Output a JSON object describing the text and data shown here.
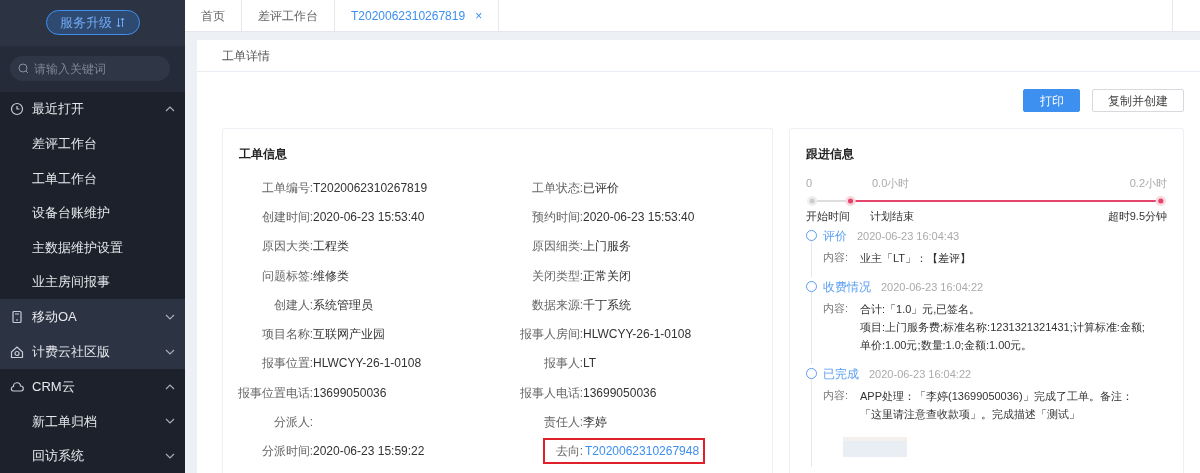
{
  "sidebar": {
    "upgrade_button": "服务升级",
    "search": {
      "placeholder": "请输入关键词"
    },
    "groups": [
      {
        "label": "最近打开",
        "expanded": true,
        "children": [
          {
            "label": "差评工作台"
          },
          {
            "label": "工单工作台"
          },
          {
            "label": "设备台账维护"
          },
          {
            "label": "主数据维护设置"
          },
          {
            "label": "业主房间报事"
          }
        ]
      },
      {
        "label": "移动OA",
        "expanded": false
      },
      {
        "label": "计费云社区版",
        "expanded": false
      },
      {
        "label": "CRM云",
        "expanded": true,
        "children": [
          {
            "label": "新工单归档",
            "expanded": false
          },
          {
            "label": "回访系统",
            "expanded": false
          }
        ]
      }
    ]
  },
  "tabs": [
    {
      "label": "首页",
      "selected": false
    },
    {
      "label": "差评工作台",
      "selected": false
    },
    {
      "label": "T2020062310267819",
      "selected": true,
      "close": "×"
    }
  ],
  "page": {
    "title": "工单详情",
    "buttons": [
      {
        "label": "打印",
        "kind": "primary"
      },
      {
        "label": "复制并创建",
        "kind": "default"
      }
    ]
  },
  "order_info": {
    "title": "工单信息",
    "rows": [
      [
        {
          "label": "工单编号:",
          "value": "T2020062310267819"
        },
        {
          "label": "工单状态:",
          "value": "已评价"
        }
      ],
      [
        {
          "label": "创建时间:",
          "value": "2020-06-23 15:53:40"
        },
        {
          "label": "预约时间:",
          "value": "2020-06-23 15:53:40"
        }
      ],
      [
        {
          "label": "原因大类:",
          "value": "工程类"
        },
        {
          "label": "原因细类:",
          "value": "上门服务"
        }
      ],
      [
        {
          "label": "问题标签:",
          "value": "维修类"
        },
        {
          "label": "关闭类型:",
          "value": "正常关闭"
        }
      ],
      [
        {
          "label": "创建人:",
          "value": "系统管理员"
        },
        {
          "label": "数据来源:",
          "value": "千丁系统"
        }
      ],
      [
        {
          "label": "项目名称:",
          "value": "互联网产业园"
        },
        {
          "label": "报事人房间:",
          "value": "HLWCYY-26-1-0108"
        }
      ],
      [
        {
          "label": "报事位置:",
          "value": "HLWCYY-26-1-0108"
        },
        {
          "label": "报事人:",
          "value": "LT"
        }
      ],
      [
        {
          "label": "报事位置电话:",
          "value": "13699050036"
        },
        {
          "label": "报事人电话:",
          "value": "13699050036"
        }
      ],
      [
        {
          "label": "分派人:"
        },
        {
          "label": "责任人:",
          "value": "李婷"
        }
      ],
      [
        {
          "label": "分派时间:",
          "value": "2020-06-23 15:59:22"
        },
        {
          "label": "去向:",
          "value": "T2020062310267948",
          "kind": "link",
          "highlighted": true
        }
      ]
    ]
  },
  "follow_up": {
    "title": "跟进信息",
    "progress": {
      "level": 0.11,
      "ticks": [
        "0",
        "0.0小时",
        "0.2小时"
      ],
      "labels": [
        "开始时间",
        "计划结束",
        "超时9.5分钟"
      ]
    },
    "entries": [
      {
        "title": "评价",
        "time": "2020-06-23 16:04:43",
        "content_label": "内容:",
        "lines": [
          "业主「LT」：【差评】"
        ],
        "photo": false
      },
      {
        "title": "收费情况",
        "time": "2020-06-23 16:04:22",
        "content_label": "内容:",
        "lines": [
          "合计:「1.0」元,已签名。",
          "项目:上门服务费;标准名称:1231321321431;计算标准:金额;",
          "单价:1.00元;数量:1.0;金额:1.00元。"
        ],
        "photo": false
      },
      {
        "title": "已完成",
        "time": "2020-06-23 16:04:22",
        "content_label": "内容:",
        "lines": [
          "APP处理：「李婷(13699050036)」完成了工单。备注：",
          "「这里请注意查收款项」。完成描述「测试」"
        ],
        "photo": true
      }
    ]
  }
}
